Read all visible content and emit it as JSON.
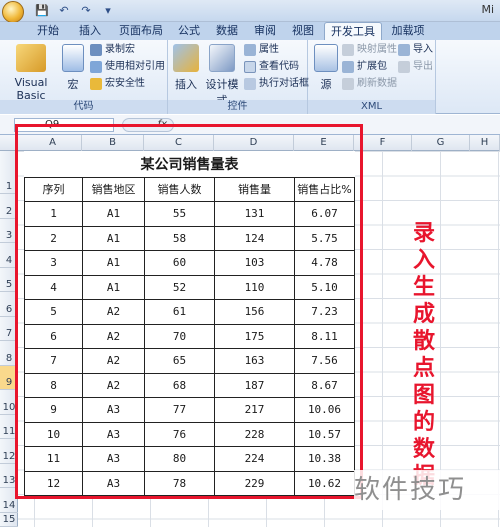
{
  "quick_access": {
    "save_icon": "save-icon",
    "undo_icon": "undo-icon",
    "redo_icon": "redo-icon"
  },
  "titlebar": {
    "right_text": "Mi"
  },
  "tabs": [
    "开始",
    "插入",
    "页面布局",
    "公式",
    "数据",
    "审阅",
    "视图",
    "开发工具",
    "加载项"
  ],
  "active_tab": "开发工具",
  "ribbon": {
    "code": {
      "label": "代码",
      "visual_basic": "Visual Basic",
      "macros": "宏",
      "record_macro": "录制宏",
      "relative_refs": "使用相对引用",
      "macro_security": "宏安全性"
    },
    "controls": {
      "label": "控件",
      "insert": "插入",
      "design_mode": "设计模式",
      "properties": "属性",
      "view_code": "查看代码",
      "run_dialog": "执行对话框"
    },
    "xml": {
      "label": "XML",
      "source": "源",
      "map_properties": "映射属性",
      "expansion_packs": "扩展包",
      "refresh_data": "刷新数据",
      "import": "导入",
      "export": "导出"
    }
  },
  "formula_bar": {
    "name_box": "Q9",
    "fx": "fx"
  },
  "columns": [
    "A",
    "B",
    "C",
    "D",
    "E",
    "F",
    "G",
    "H"
  ],
  "rows": [
    "1",
    "2",
    "3",
    "4",
    "5",
    "6",
    "7",
    "8",
    "9",
    "10",
    "11",
    "12",
    "13",
    "14",
    "15"
  ],
  "table": {
    "title": "某公司销售量表",
    "headers": [
      "序列",
      "销售地区",
      "销售人数",
      "销售量",
      "销售占比%"
    ],
    "rows": [
      [
        "1",
        "A1",
        "55",
        "131",
        "6.07"
      ],
      [
        "2",
        "A1",
        "58",
        "124",
        "5.75"
      ],
      [
        "3",
        "A1",
        "60",
        "103",
        "4.78"
      ],
      [
        "4",
        "A1",
        "52",
        "110",
        "5.10"
      ],
      [
        "5",
        "A2",
        "61",
        "156",
        "7.23"
      ],
      [
        "6",
        "A2",
        "70",
        "175",
        "8.11"
      ],
      [
        "7",
        "A2",
        "65",
        "163",
        "7.56"
      ],
      [
        "8",
        "A2",
        "68",
        "187",
        "8.67"
      ],
      [
        "9",
        "A3",
        "77",
        "217",
        "10.06"
      ],
      [
        "10",
        "A3",
        "76",
        "228",
        "10.57"
      ],
      [
        "11",
        "A3",
        "80",
        "224",
        "10.38"
      ],
      [
        "12",
        "A3",
        "78",
        "229",
        "10.62"
      ]
    ]
  },
  "annotation": "录入生成散点图的数据",
  "watermark": "软件技巧",
  "colors": {
    "annotation": "#e8152d",
    "ribbon": "#dde8f6",
    "selected_row": "#f9d98c"
  }
}
